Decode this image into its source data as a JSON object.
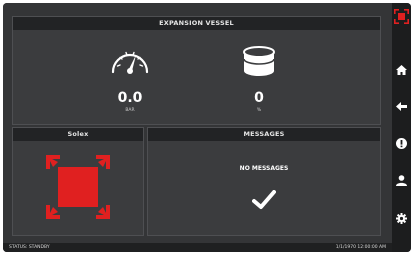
{
  "expansion_vessel": {
    "title": "EXPANSION VESSEL",
    "pressure": {
      "value": "0.0",
      "unit": "BAR",
      "icon": "pressure-gauge-icon"
    },
    "level": {
      "value": "0",
      "unit": "%",
      "icon": "tank-level-icon"
    }
  },
  "solex": {
    "title": "Solex",
    "icon": "solex-device-icon",
    "color": "#e02020"
  },
  "messages": {
    "title": "MESSAGES",
    "empty_text": "NO MESSAGES",
    "icon": "checkmark-icon"
  },
  "status": {
    "text": "STATUS: STANDBY",
    "datetime": "1/1/1970 12:00:00 AM"
  },
  "sidebar": {
    "items": [
      {
        "name": "solex-logo",
        "icon": "solex-logo-icon"
      },
      {
        "name": "home",
        "icon": "home-icon"
      },
      {
        "name": "back",
        "icon": "back-arrow-icon"
      },
      {
        "name": "alerts",
        "icon": "exclamation-icon"
      },
      {
        "name": "user",
        "icon": "user-icon"
      },
      {
        "name": "settings",
        "icon": "gear-icon"
      }
    ]
  },
  "colors": {
    "accent_red": "#e02020",
    "background": "#343537",
    "panel": "#3b3c3e"
  }
}
